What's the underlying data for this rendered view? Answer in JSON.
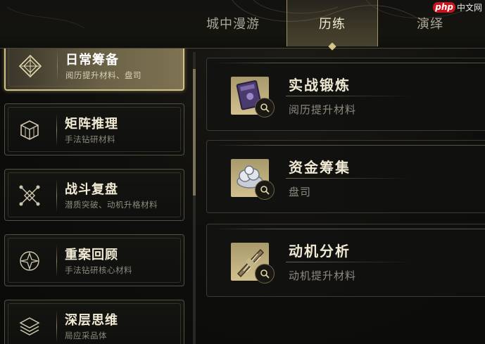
{
  "tabs": [
    {
      "label": "城中漫游",
      "active": false
    },
    {
      "label": "历练",
      "active": true
    },
    {
      "label": "演绎",
      "active": false
    }
  ],
  "watermark": {
    "badge": "php",
    "text": "中文网"
  },
  "categories": [
    {
      "title": "日常筹备",
      "subtitle": "阅历提升材料、盘司",
      "icon": "diamond-compass-icon",
      "active": true
    },
    {
      "title": "矩阵推理",
      "subtitle": "手法钻研材料",
      "icon": "cube-matrix-icon",
      "active": false
    },
    {
      "title": "战斗复盘",
      "subtitle": "潜质突破、动机升格材料",
      "icon": "crossed-nodes-icon",
      "active": false
    },
    {
      "title": "重案回顾",
      "subtitle": "手法钻研核心材料",
      "icon": "star-swirl-icon",
      "active": false
    },
    {
      "title": "深层思维",
      "subtitle": "局应采品体",
      "icon": "layers-icon",
      "active": false
    }
  ],
  "items": [
    {
      "name": "实战锻炼",
      "desc": "阅历提升材料",
      "icon": "purple-book-icon"
    },
    {
      "name": "资金筹集",
      "desc": "盘司",
      "icon": "coin-pile-icon"
    },
    {
      "name": "动机分析",
      "desc": "动机提升材料",
      "icon": "scroll-feather-icon"
    }
  ],
  "colors": {
    "accent": "#d2c187",
    "background": "#0d0d0c",
    "text_primary": "#f1ead4",
    "text_secondary": "#8d8a7e"
  }
}
